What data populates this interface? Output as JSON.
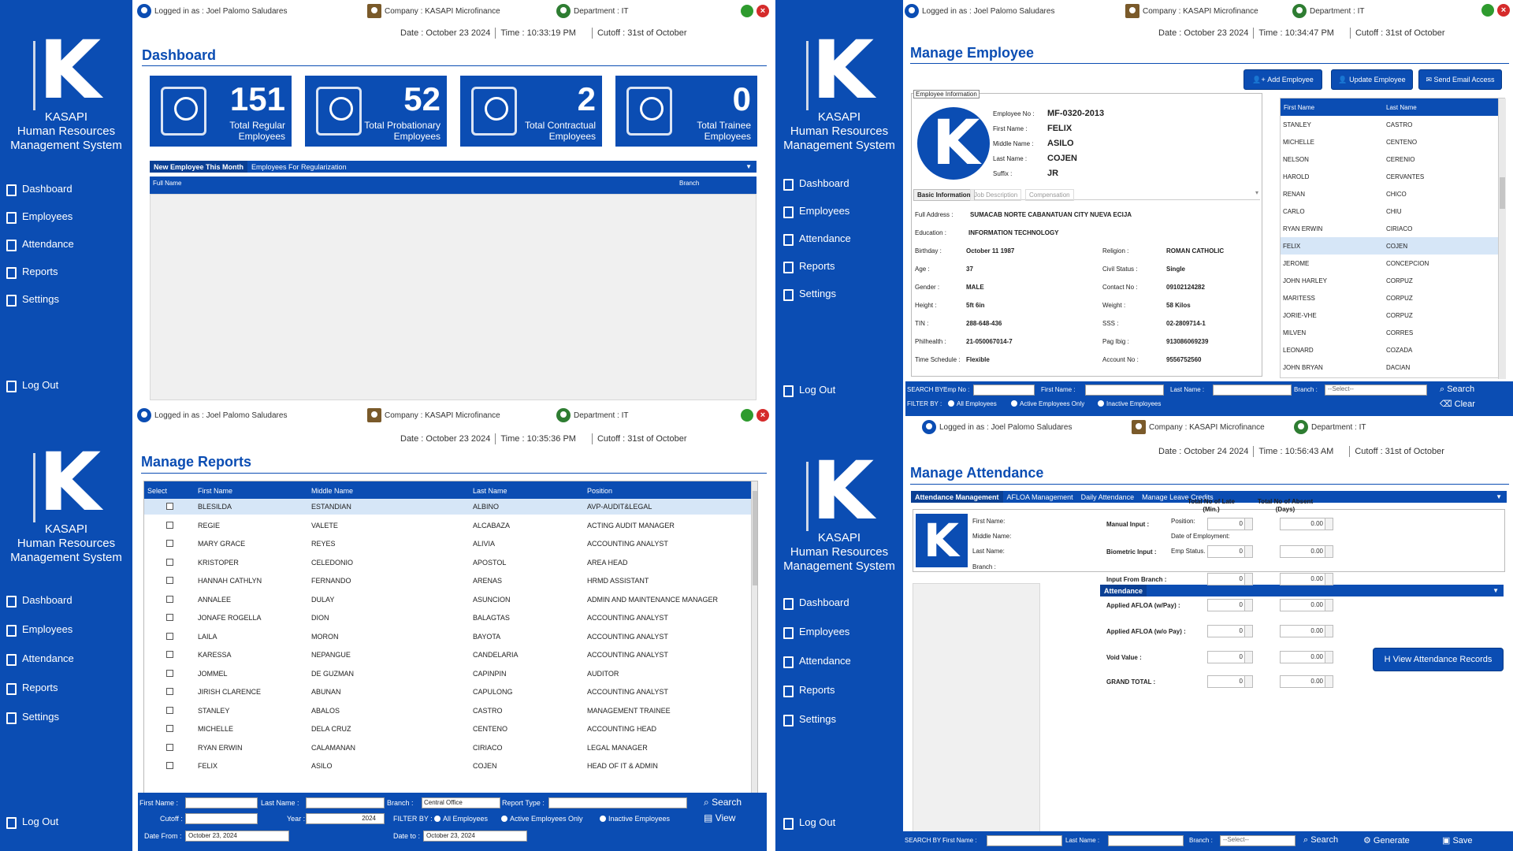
{
  "app": {
    "brand_letter": "K",
    "brand_line1": "KASAPI",
    "brand_line2": "Human Resources",
    "brand_line3": "Management System"
  },
  "nav": {
    "dashboard": "Dashboard",
    "employees": "Employees",
    "attendance": "Attendance",
    "reports": "Reports",
    "settings": "Settings",
    "logout": "Log Out"
  },
  "topbar": {
    "logged": "Logged in as : Joel Palomo Saludares",
    "company": "Company : KASAPI Microfinance",
    "department": "Department : IT",
    "cutoff": "Cutoff : 31st of October"
  },
  "colors": {
    "primary": "#0b4db3",
    "close": "#d52b2b",
    "minimize": "#2e9b2e"
  },
  "dashboard": {
    "date": "Date : October 23 2024",
    "time_label": "Time :",
    "time": "10:33:19 PM",
    "title": "Dashboard",
    "cards": [
      {
        "num": "151",
        "label": "Total Regular Employees"
      },
      {
        "num": "52",
        "label": "Total Probationary Employees"
      },
      {
        "num": "2",
        "label": "Total Contractual Employees"
      },
      {
        "num": "0",
        "label": "Total Trainee Employees"
      }
    ],
    "tabs": [
      "New Employee This Month",
      "Employees For Regularization"
    ],
    "cols": [
      "Full Name",
      "Branch"
    ]
  },
  "employee": {
    "date": "Date : October 23 2024",
    "time_label": "Time :",
    "time": "10:34:47 PM",
    "title": "Manage Employee",
    "buttons": {
      "add": "Add Employee",
      "update": "Update Employee",
      "email": "Send Email Access"
    },
    "info_group": "Employee Information",
    "labels": {
      "emp_no": "Employee No :",
      "first": "First Name :",
      "middle": "Middle Name :",
      "last": "Last Name :",
      "suffix": "Suffix :"
    },
    "values": {
      "emp_no": "MF-0320-2013",
      "first": "FELIX",
      "middle": "ASILO",
      "last": "COJEN",
      "suffix": "JR"
    },
    "tabs": [
      "Basic Information",
      "Job Description",
      "Compensation"
    ],
    "basic": {
      "address_l": "Full Address :",
      "address": "SUMACAB NORTE CABANATUAN CITY  NUEVA ECIJA",
      "edu_l": "Education :",
      "edu": "INFORMATION TECHNOLOGY",
      "birthday_l": "Birthday :",
      "birthday": "October 11 1987",
      "religion_l": "Religion :",
      "religion": "ROMAN CATHOLIC",
      "age_l": "Age :",
      "age": "37",
      "civil_l": "Civil Status :",
      "civil": "Single",
      "gender_l": "Gender :",
      "gender": "MALE",
      "contact_l": "Contact No :",
      "contact": "09102124282",
      "height_l": "Height :",
      "height": "5ft 6in",
      "weight_l": "Weight :",
      "weight": "58 Kilos",
      "tin_l": "TIN :",
      "tin": "288-648-436",
      "sss_l": "SSS :",
      "sss": "02-2809714-1",
      "phil_l": "Philhealth :",
      "phil": "21-050067014-7",
      "pagibig_l": "Pag Ibig :",
      "pagibig": "913086069239",
      "sched_l": "Time Schedule :",
      "sched": "Flexible",
      "acct_l": "Account No :",
      "acct": "9556752560"
    },
    "list_cols": [
      "First Name",
      "Last Name"
    ],
    "list": [
      [
        "STANLEY",
        "CASTRO"
      ],
      [
        "MICHELLE",
        "CENTENO"
      ],
      [
        "NELSON",
        "CERENIO"
      ],
      [
        "HAROLD",
        "CERVANTES"
      ],
      [
        "RENAN",
        "CHICO"
      ],
      [
        "CARLO",
        "CHIU"
      ],
      [
        "RYAN ERWIN",
        "CIRIACO"
      ],
      [
        "FELIX",
        "COJEN"
      ],
      [
        "JEROME",
        "CONCEPCION"
      ],
      [
        "JOHN HARLEY",
        "CORPUZ"
      ],
      [
        "MARITESS",
        "CORPUZ"
      ],
      [
        "JORIE-VHE",
        "CORPUZ"
      ],
      [
        "MILVEN",
        "CORRES"
      ],
      [
        "LEONARD",
        "COZADA"
      ],
      [
        "JOHN BRYAN",
        "DACIAN"
      ]
    ],
    "search": {
      "by": "SEARCH BY :",
      "emp_no": "Emp No :",
      "first": "First Name :",
      "last": "Last Name :",
      "branch": "Branch :",
      "branch_sel": "--Select--",
      "search": "Search",
      "clear": "Clear",
      "filter": "FILTER BY :",
      "all": "All Employees",
      "active": "Active Employees Only",
      "inactive": "Inactive Employees"
    }
  },
  "reports": {
    "date": "Date : October 23 2024",
    "time_label": "Time :",
    "time": "10:35:36 PM",
    "title": "Manage Reports",
    "cols": [
      "Select",
      "First Name",
      "Middle Name",
      "Last Name",
      "Position"
    ],
    "rows": [
      [
        "BLESILDA",
        "ESTANDIAN",
        "ALBINO",
        "AVP-AUDIT&LEGAL"
      ],
      [
        "REGIE",
        "VALETE",
        "ALCABAZA",
        "ACTING AUDIT MANAGER"
      ],
      [
        "MARY GRACE",
        "REYES",
        "ALIVIA",
        "ACCOUNTING ANALYST"
      ],
      [
        "KRISTOPER",
        "CELEDONIO",
        "APOSTOL",
        "AREA HEAD"
      ],
      [
        "HANNAH CATHLYN",
        "FERNANDO",
        "ARENAS",
        "HRMD ASSISTANT"
      ],
      [
        "ANNALEE",
        "DULAY",
        "ASUNCION",
        "ADMIN AND MAINTENANCE MANAGER"
      ],
      [
        "JONAFE ROGELLA",
        "DION",
        "BALAGTAS",
        "ACCOUNTING ANALYST"
      ],
      [
        "LAILA",
        "MORON",
        "BAYOTA",
        "ACCOUNTING ANALYST"
      ],
      [
        "KARESSA",
        "NEPANGUE",
        "CANDELARIA",
        "ACCOUNTING ANALYST"
      ],
      [
        "JOMMEL",
        "DE GUZMAN",
        "CAPINPIN",
        "AUDITOR"
      ],
      [
        "JIRISH CLARENCE",
        "ABUNAN",
        "CAPULONG",
        "ACCOUNTING ANALYST"
      ],
      [
        "STANLEY",
        "ABALOS",
        "CASTRO",
        "MANAGEMENT TRAINEE"
      ],
      [
        "MICHELLE",
        "DELA CRUZ",
        "CENTENO",
        "ACCOUNTING HEAD"
      ],
      [
        "RYAN ERWIN",
        "CALAMANAN",
        "CIRIACO",
        "LEGAL MANAGER"
      ],
      [
        "FELIX",
        "ASILO",
        "COJEN",
        "HEAD OF IT & ADMIN"
      ]
    ],
    "filters": {
      "first": "First Name :",
      "last": "Last Name :",
      "branch": "Branch :",
      "branch_val": "Central Office",
      "rtype": "Report Type :",
      "cutoff": "Cutoff :",
      "year": "Year :",
      "year_val": "2024",
      "filter": "FILTER BY :",
      "all": "All Employees",
      "active": "Active Employees Only",
      "inactive": "Inactive Employees",
      "date_from": "Date From :",
      "date_from_val": "October  23, 2024",
      "date_to": "Date to :",
      "date_to_val": "October  23, 2024",
      "search": "Search",
      "view": "View"
    }
  },
  "attendance": {
    "date": "Date : October 24 2024",
    "time_label": "Time :",
    "time": "10:56:43 AM",
    "title": "Manage Attendance",
    "tabs": [
      "Attendance Management",
      "AFLOA Management",
      "Daily Attendance",
      "Manage Leave Credits"
    ],
    "labels": {
      "first": "First Name:",
      "middle": "Middle Name:",
      "last": "Last Name:",
      "branch": "Branch :",
      "position": "Position:",
      "doe": "Date of Employment:",
      "status": "Emp Status."
    },
    "section": "Attendance",
    "col1": "Total No of Late (Min.)",
    "col2": "Total No of Absent (Days)",
    "rows": [
      {
        "label": "Manual Input :",
        "late": "0",
        "absent": "0.00"
      },
      {
        "label": "Biometric Input :",
        "late": "0",
        "absent": "0.00"
      },
      {
        "label": "Input From Branch :",
        "late": "0",
        "absent": "0.00"
      },
      {
        "label": "Applied AFLOA (w/Pay) :",
        "late": "0",
        "absent": "0.00"
      },
      {
        "label": "Applied AFLOA (w/o Pay) :",
        "late": "0",
        "absent": "0.00"
      },
      {
        "label": "Void Value :",
        "late": "0",
        "absent": "0.00"
      },
      {
        "label": "GRAND TOTAL :",
        "late": "0",
        "absent": "0.00"
      }
    ],
    "view_btn": "View Attendance Records",
    "search": {
      "by": "SEARCH BY :",
      "first": "First Name :",
      "last": "Last Name :",
      "branch": "Branch :",
      "branch_sel": "--Select--",
      "search": "Search",
      "generate": "Generate",
      "save": "Save"
    }
  }
}
